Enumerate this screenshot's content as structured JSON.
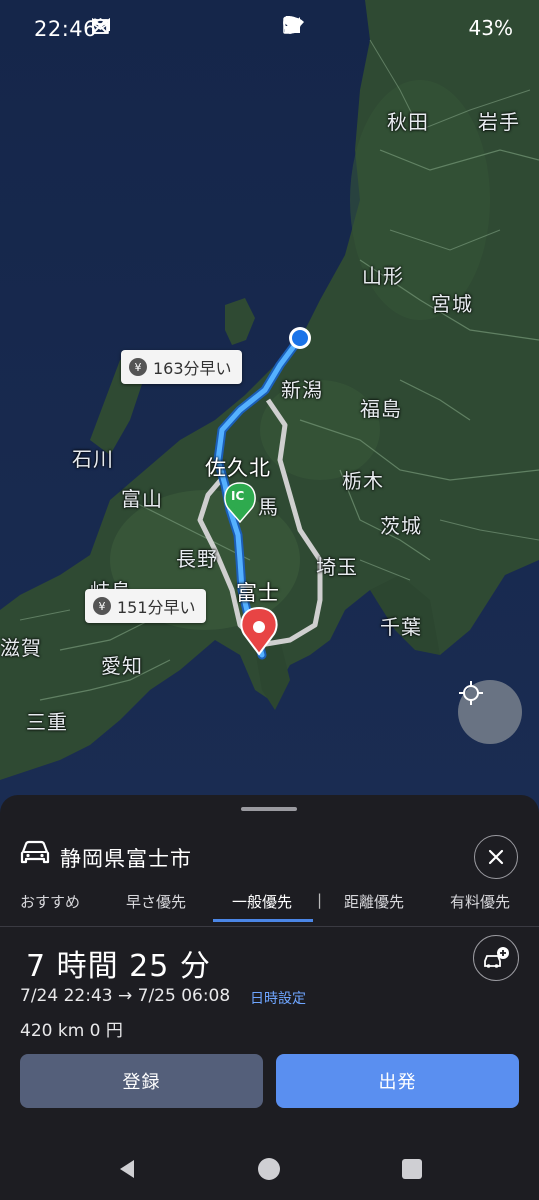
{
  "status_bar": {
    "time": "22:46",
    "battery": "43%",
    "left_icons": [
      "calendar-icon",
      "mail-icon",
      "gmail-icon",
      "x-icon",
      "dot-icon"
    ],
    "right_icons": [
      "dot-icon",
      "location-icon",
      "dnd-icon",
      "wifi-icon",
      "signal-icon",
      "battery-icon"
    ]
  },
  "map": {
    "labels": {
      "akita": "秋田",
      "iwate": "岩手",
      "yamagata": "山形",
      "miyagi": "宮城",
      "niigata": "新潟",
      "fukushima": "福島",
      "ishikawa": "石川",
      "saku_kita": "佐久北",
      "toyama": "富山",
      "tochigi": "栃木",
      "gunma_partial": "馬",
      "ibaraki": "茨城",
      "nagano": "長野",
      "saitama": "埼玉",
      "fuji": "富士",
      "gifu": "岐阜",
      "shiga": "滋賀",
      "chiba": "千葉",
      "aichi": "愛知",
      "mie": "三重"
    },
    "badges": {
      "badge_top": "163分早い",
      "badge_bottom": "151分早い",
      "yen_symbol": "¥"
    },
    "ic_marker": "IC",
    "colors": {
      "route_primary": "#4aa3ff",
      "route_alt": "#c8c8c8",
      "ic_marker": "#2eaa4e",
      "destination_pin": "#e84444",
      "origin_dot": "#1a73e8"
    }
  },
  "sheet": {
    "destination": "静岡県富士市",
    "tabs": [
      {
        "label": "おすすめ",
        "active": false
      },
      {
        "label": "早さ優先",
        "active": false
      },
      {
        "label": "一般優先",
        "active": true
      },
      {
        "label": "距離優先",
        "active": false
      },
      {
        "label": "有料優先",
        "active": false
      }
    ],
    "tab_separator": "|",
    "duration": "7 時間 25 分",
    "time_range": "7/24 22:43 → 7/25 06:08",
    "time_setting_link": "日時設定",
    "distance_cost": "420 km  0 円",
    "register_button": "登録",
    "start_button": "出発"
  }
}
